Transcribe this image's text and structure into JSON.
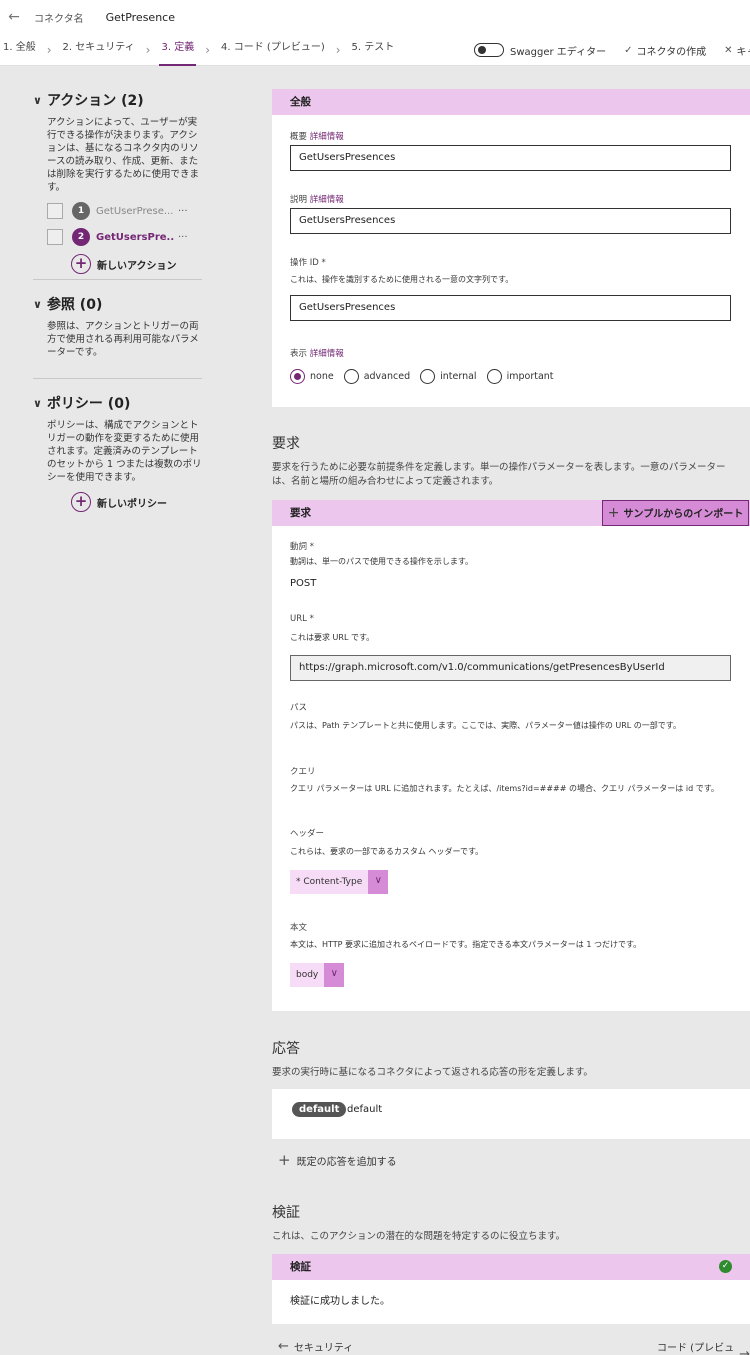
{
  "header": {
    "connector_label": "コネクタ名",
    "connector_name": "GetPresence"
  },
  "steps": [
    "1. 全般",
    "2. セキュリティ",
    "3. 定義",
    "4. コード (プレビュー)",
    "5. テスト"
  ],
  "tools": {
    "swagger": "Swagger エディター",
    "create": "コネクタの作成",
    "cancel": "キャンセル"
  },
  "sidebar": {
    "actions": {
      "title": "アクション (2)",
      "desc": "アクションによって、ユーザーが実行できる操作が決まります。アクションは、基になるコネクタ内のリソースの読み取り、作成、更新、または削除を実行するために使用できます。",
      "items": [
        {
          "num": "1",
          "label": "GetUserPrese..."
        },
        {
          "num": "2",
          "label": "GetUsersPre..."
        }
      ],
      "add": "新しいアクション"
    },
    "refs": {
      "title": "参照 (0)",
      "desc": "参照は、アクションとトリガーの両方で使用される再利用可能なパラメーターです。"
    },
    "policies": {
      "title": "ポリシー (0)",
      "desc": "ポリシーは、構成でアクションとトリガーの動作を変更するために使用されます。定義済みのテンプレートのセットから 1 つまたは複数のポリシーを使用できます。",
      "add": "新しいポリシー"
    }
  },
  "general": {
    "header": "全般",
    "summary_label": "概要",
    "detail_link": "詳細情報",
    "summary_value": "GetUsersPresences",
    "desc_label": "説明",
    "desc_value": "GetUsersPresences",
    "opid_label": "操作 ID *",
    "opid_help": "これは、操作を識別するために使用される一意の文字列です。",
    "opid_value": "GetUsersPresences",
    "vis_label": "表示",
    "vis_options": [
      "none",
      "advanced",
      "internal",
      "important"
    ],
    "vis_selected": "none"
  },
  "request": {
    "title": "要求",
    "desc": "要求を行うために必要な前提条件を定義します。単一の操作パラメーターを表します。一意のパラメーターは、名前と場所の組み合わせによって定義されます。",
    "header": "要求",
    "import": "サンプルからのインポート",
    "verb_label": "動詞 *",
    "verb_help": "動詞は、単一のパスで使用できる操作を示します。",
    "verb_value": "POST",
    "url_label": "URL *",
    "url_help": "これは要求 URL です。",
    "url_value": "https://graph.microsoft.com/v1.0/communications/getPresencesByUserId",
    "path_label": "パス",
    "path_help": "パスは、Path テンプレートと共に使用します。ここでは、実際、パラメーター値は操作の URL の一部です。",
    "query_label": "クエリ",
    "query_help": "クエリ パラメーターは URL に追加されます。たとえば、/items?id=#### の場合、クエリ パラメーターは id です。",
    "headers_label": "ヘッダー",
    "headers_help": "これらは、要求の一部であるカスタム ヘッダーです。",
    "headers_item": "* Content-Type",
    "body_label": "本文",
    "body_help": "本文は、HTTP 要求に追加されるペイロードです。指定できる本文パラメーターは 1 つだけです。",
    "body_item": "body"
  },
  "response": {
    "title": "応答",
    "desc": "要求の実行時に基になるコネクタによって返される応答の形を定義します。",
    "badge": "default",
    "text": "default",
    "add": "既定の応答を追加する"
  },
  "validation": {
    "title": "検証",
    "desc": "これは、このアクションの潜在的な問題を特定するのに役立ちます。",
    "header": "検証",
    "result": "検証に成功しました。"
  },
  "nav": {
    "prev": "セキュリティ",
    "next": "コード (プレビュー)"
  }
}
